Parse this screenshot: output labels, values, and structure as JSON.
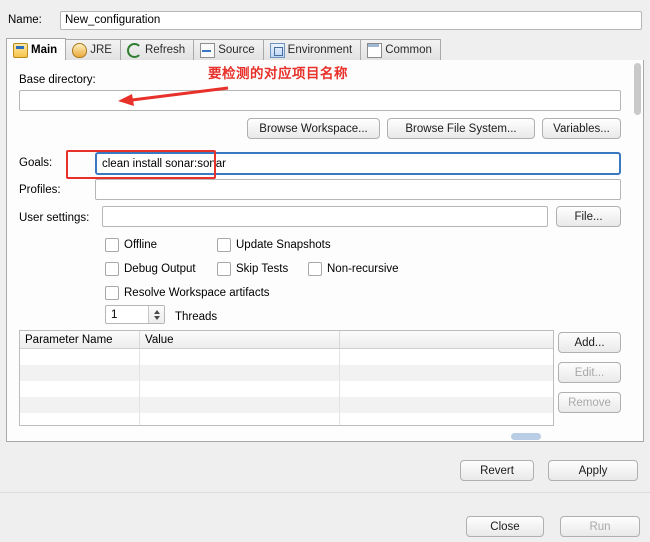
{
  "window": {
    "name_label": "Name:",
    "name_value": "New_configuration"
  },
  "tabs": [
    {
      "label": "Main",
      "icon": "wrench-main-icon",
      "active": true
    },
    {
      "label": "JRE",
      "icon": "java-jre-icon",
      "active": false
    },
    {
      "label": "Refresh",
      "icon": "refresh-arrow-icon",
      "active": false
    },
    {
      "label": "Source",
      "icon": "source-folder-icon",
      "active": false
    },
    {
      "label": "Environment",
      "icon": "environment-icon",
      "active": false
    },
    {
      "label": "Common",
      "icon": "common-sheet-icon",
      "active": false
    }
  ],
  "main": {
    "base_directory_label": "Base directory:",
    "base_directory_value": "",
    "browse_workspace_label": "Browse Workspace...",
    "browse_file_system_label": "Browse File System...",
    "variables_label": "Variables...",
    "goals_label": "Goals:",
    "goals_value": "clean install sonar:sonar",
    "profiles_label": "Profiles:",
    "profiles_value": "",
    "user_settings_label": "User settings:",
    "user_settings_value": "",
    "file_button_label": "File...",
    "checkboxes": [
      {
        "label": "Offline",
        "checked": false
      },
      {
        "label": "Update Snapshots",
        "checked": false
      },
      {
        "label": "Debug Output",
        "checked": false
      },
      {
        "label": "Skip Tests",
        "checked": false
      },
      {
        "label": "Non-recursive",
        "checked": false
      },
      {
        "label": "Resolve Workspace artifacts",
        "checked": false
      }
    ],
    "threads_label": "Threads",
    "threads_value": "1",
    "table": {
      "headers": [
        "Parameter Name",
        "Value",
        ""
      ],
      "rows": [
        [
          "",
          "",
          ""
        ],
        [
          "",
          "",
          ""
        ],
        [
          "",
          "",
          ""
        ],
        [
          "",
          "",
          ""
        ],
        [
          "",
          "",
          ""
        ]
      ]
    },
    "table_buttons": [
      {
        "label": "Add...",
        "enabled": true
      },
      {
        "label": "Edit...",
        "enabled": false
      },
      {
        "label": "Remove",
        "enabled": false
      }
    ]
  },
  "footer": {
    "revert_label": "Revert",
    "apply_label": "Apply",
    "close_label": "Close",
    "run_label": "Run"
  },
  "annotations": {
    "callout_text": "要检测的对应项目名称",
    "callout_color": "#e8312a"
  }
}
